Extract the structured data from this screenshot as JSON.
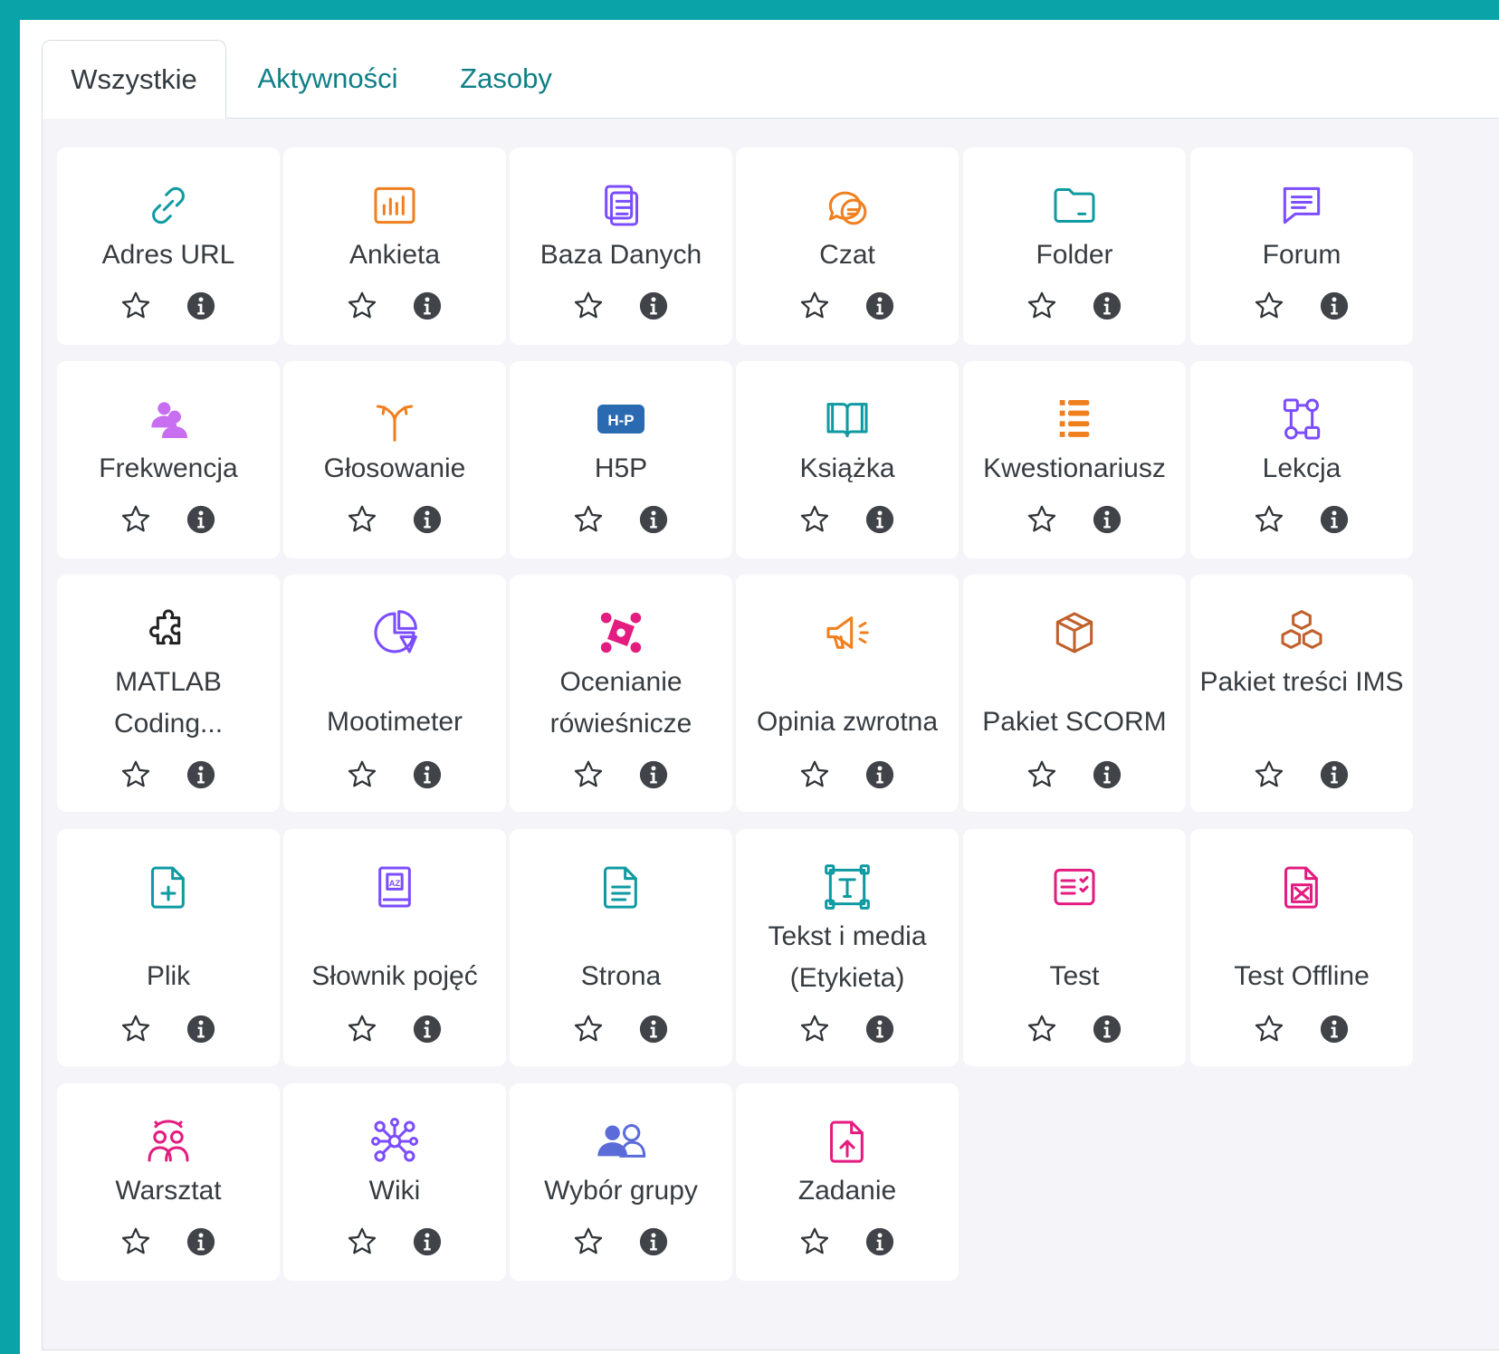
{
  "tabs": [
    {
      "label": "Wszystkie",
      "active": true
    },
    {
      "label": "Aktywności",
      "active": false
    },
    {
      "label": "Zasoby",
      "active": false
    }
  ],
  "modules": [
    {
      "label": "Adres URL",
      "icon": "link-icon",
      "color": "#0f9aa1"
    },
    {
      "label": "Ankieta",
      "icon": "bar-chart-icon",
      "color": "#f07f1e"
    },
    {
      "label": "Baza Danych",
      "icon": "database-icon",
      "color": "#7b4dff"
    },
    {
      "label": "Czat",
      "icon": "chat-icon",
      "color": "#f07f1e"
    },
    {
      "label": "Folder",
      "icon": "folder-icon",
      "color": "#0f9aa1"
    },
    {
      "label": "Forum",
      "icon": "forum-icon",
      "color": "#7b4dff"
    },
    {
      "label": "Frekwencja",
      "icon": "attendance-icon",
      "color": "#c86ef0"
    },
    {
      "label": "Głosowanie",
      "icon": "choice-icon",
      "color": "#f07f1e"
    },
    {
      "label": "H5P",
      "icon": "h5p-icon",
      "color": "#2a6ab0",
      "badge": "H-P"
    },
    {
      "label": "Książka",
      "icon": "book-icon",
      "color": "#0f9aa1"
    },
    {
      "label": "Kwestionariusz",
      "icon": "questionnaire-icon",
      "color": "#f07f1e"
    },
    {
      "label": "Lekcja",
      "icon": "lesson-icon",
      "color": "#7b4dff"
    },
    {
      "label": "MATLAB Coding...",
      "icon": "puzzle-icon",
      "color": "#222222"
    },
    {
      "label": "Mootimeter",
      "icon": "pie-chart-icon",
      "color": "#7b4dff"
    },
    {
      "label": "Ocenianie rówieśnicze",
      "icon": "peer-review-icon",
      "color": "#e31c80"
    },
    {
      "label": "Opinia zwrotna",
      "icon": "megaphone-icon",
      "color": "#f07f1e"
    },
    {
      "label": "Pakiet SCORM",
      "icon": "package-icon",
      "color": "#c0602a"
    },
    {
      "label": "Pakiet treści IMS",
      "icon": "boxes-icon",
      "color": "#c0602a"
    },
    {
      "label": "Plik",
      "icon": "file-plus-icon",
      "color": "#0f9aa1"
    },
    {
      "label": "Słownik pojęć",
      "icon": "glossary-icon",
      "color": "#7b4dff"
    },
    {
      "label": "Strona",
      "icon": "page-icon",
      "color": "#0f9aa1"
    },
    {
      "label": "Tekst i media (Etykieta)",
      "icon": "text-icon",
      "color": "#0f9aa1"
    },
    {
      "label": "Test",
      "icon": "quiz-icon",
      "color": "#e31c80"
    },
    {
      "label": "Test Offline",
      "icon": "offline-quiz-icon",
      "color": "#e31c80"
    },
    {
      "label": "Warsztat",
      "icon": "workshop-icon",
      "color": "#e31c80"
    },
    {
      "label": "Wiki",
      "icon": "wiki-icon",
      "color": "#7b4dff"
    },
    {
      "label": "Wybór grupy",
      "icon": "group-choice-icon",
      "color": "#5b6bd8"
    },
    {
      "label": "Zadanie",
      "icon": "assignment-icon",
      "color": "#e31c80"
    }
  ]
}
